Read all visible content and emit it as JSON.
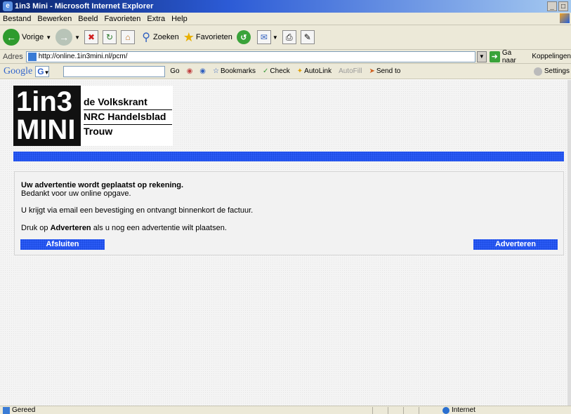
{
  "window": {
    "title": "1in3 Mini - Microsoft Internet Explorer",
    "controls": [
      "_",
      "□"
    ]
  },
  "menubar": {
    "items": [
      "Bestand",
      "Bewerken",
      "Beeld",
      "Favorieten",
      "Extra",
      "Help"
    ]
  },
  "toolbar": {
    "back_label": "Vorige",
    "search_label": "Zoeken",
    "favorites_label": "Favorieten"
  },
  "address": {
    "label": "Adres",
    "url": "http://online.1in3mini.nl/pcm/",
    "go_label": "Ga naar",
    "links_label": "Koppelingen"
  },
  "googlebar": {
    "logo": "Google",
    "g_box": "G",
    "go_label": "Go",
    "bookmarks_label": "Bookmarks",
    "check_label": "Check",
    "autolink_label": "AutoLink",
    "autofill_label": "AutoFill",
    "sendto_label": "Send to",
    "settings_label": "Settings"
  },
  "logo": {
    "line1": "1in3",
    "line2": "MINI",
    "papers": [
      "de Volkskrant",
      "NRC Handelsblad",
      "Trouw"
    ]
  },
  "message": {
    "heading": "Uw advertentie wordt geplaatst op rekening.",
    "thanks": "Bedankt voor uw online opgave.",
    "confirmation": "U krijgt via email een bevestiging en ontvangt binnenkort de factuur.",
    "instruction_pre": "Druk op ",
    "instruction_bold": "Adverteren",
    "instruction_post": " als u nog een advertentie wilt plaatsen."
  },
  "buttons": {
    "close": "Afsluiten",
    "advertise": "Adverteren"
  },
  "status": {
    "text": "Gereed",
    "zone": "Internet"
  },
  "colors": {
    "accent_blue": "#2b5bf5",
    "title_bar": "#0a246a"
  }
}
